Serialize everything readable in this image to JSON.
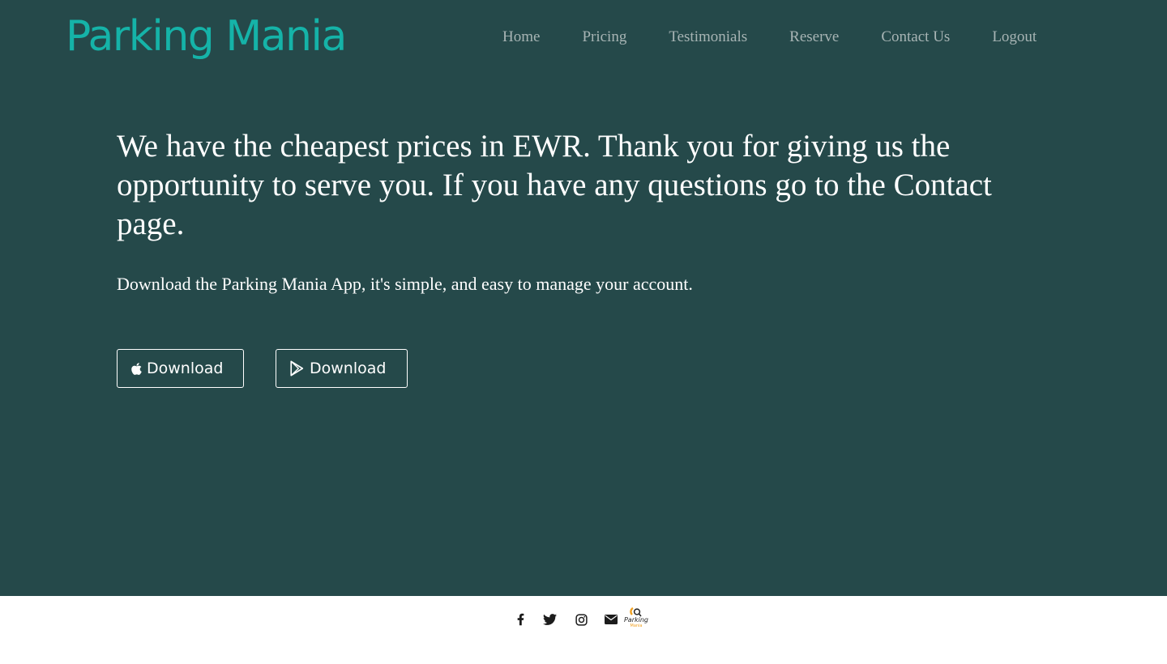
{
  "brand": {
    "name": "Parking Mania",
    "color": "#15b3a8"
  },
  "colors": {
    "hero_bg": "#25494a",
    "nav_text": "#a7b4b4",
    "footer_bg": "#ffffff",
    "logo_accent": "#f0a020"
  },
  "nav": {
    "items": [
      {
        "label": "Home"
      },
      {
        "label": "Pricing"
      },
      {
        "label": "Testimonials"
      },
      {
        "label": "Reserve"
      },
      {
        "label": "Contact Us"
      },
      {
        "label": "Logout"
      }
    ]
  },
  "hero": {
    "headline": "We have the cheapest prices in EWR. Thank you for giving us the opportunity to serve you. If you have any questions go to the Contact page.",
    "subline": "Download the Parking Mania App, it's simple, and easy to manage your account.",
    "buttons": [
      {
        "label": "Download",
        "icon": "apple-icon"
      },
      {
        "label": "Download",
        "icon": "google-play-icon"
      }
    ]
  },
  "footer": {
    "social_icons": [
      "facebook-icon",
      "twitter-icon",
      "instagram-icon",
      "envelope-icon",
      "parking-mania-logo"
    ],
    "logo_text": "Parking",
    "logo_subtext": "Mania"
  }
}
